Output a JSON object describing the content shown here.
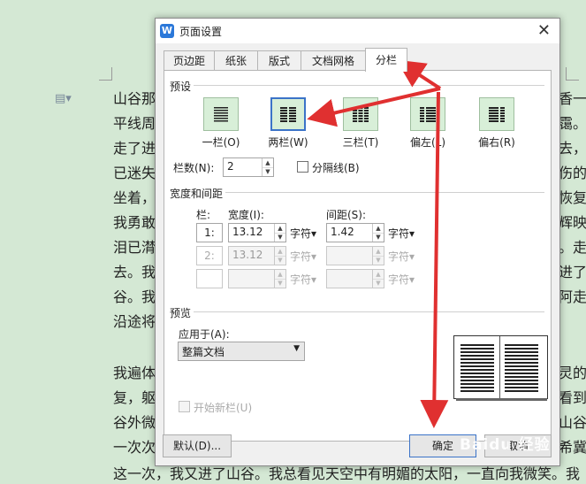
{
  "document": {
    "left_lines": [
      "山谷那",
      "平线周",
      "走了进",
      "已迷失",
      "坐着，",
      "我勇敢",
      "泪已潸",
      "去。我",
      "谷。我",
      "沿途将",
      "",
      "我遍体",
      "复，躯",
      "谷外微",
      "一次次",
      "这一次，我又进了山谷。我总看见天空中有明媚的太阳，一直向我微笑。我"
    ],
    "right_lines": [
      "香一",
      "霭。",
      "去，",
      "伤的",
      "恢复",
      "辉映",
      "。走",
      "进了",
      "阿走",
      "",
      "",
      "灵的",
      "看到",
      "山谷",
      "希冀",
      ""
    ]
  },
  "dialog": {
    "title": "页面设置",
    "close_symbol": "✕",
    "tabs": [
      {
        "label": "页边距",
        "active": false
      },
      {
        "label": "纸张",
        "active": false
      },
      {
        "label": "版式",
        "active": false
      },
      {
        "label": "文档网格",
        "active": false
      },
      {
        "label": "分栏",
        "active": true
      }
    ],
    "presets_label": "预设",
    "presets": [
      {
        "label": "一栏(O)",
        "icon": "one-column-icon",
        "selected": false
      },
      {
        "label": "两栏(W)",
        "icon": "two-column-icon",
        "selected": true
      },
      {
        "label": "三栏(T)",
        "icon": "three-column-icon",
        "selected": false
      },
      {
        "label": "偏左(L)",
        "icon": "left-column-icon",
        "selected": false
      },
      {
        "label": "偏右(R)",
        "icon": "right-column-icon",
        "selected": false
      }
    ],
    "columns_count_label": "栏数(N):",
    "columns_count_value": "2",
    "separator_label": "分隔线(B)",
    "width_spacing_label": "宽度和间距",
    "col_header": "栏:",
    "width_header": "宽度(I):",
    "spacing_header": "间距(S):",
    "rows": [
      {
        "num": "1:",
        "width": "13.12",
        "width_unit": "字符▾",
        "spacing": "1.42",
        "spacing_unit": "字符▾",
        "enabled": true
      },
      {
        "num": "2:",
        "width": "13.12",
        "width_unit": "字符▾",
        "spacing": "",
        "spacing_unit": "字符▾",
        "enabled": false
      },
      {
        "num": "",
        "width": "",
        "width_unit": "字符▾",
        "spacing": "",
        "spacing_unit": "字符▾",
        "enabled": false
      }
    ],
    "preview_label": "预览",
    "apply_to_label": "应用于(A):",
    "apply_to_value": "整篇文档",
    "new_column_label": "开始新栏(U)",
    "default_button": "默认(D)...",
    "ok_button": "确定",
    "cancel_button": "取消"
  },
  "watermark": "Baidu 经验",
  "colors": {
    "doc_background": "#d4e8d4",
    "arrow": "#e03030",
    "selected_border": "#3b73c8",
    "preset_fill": "#d8efd8"
  }
}
